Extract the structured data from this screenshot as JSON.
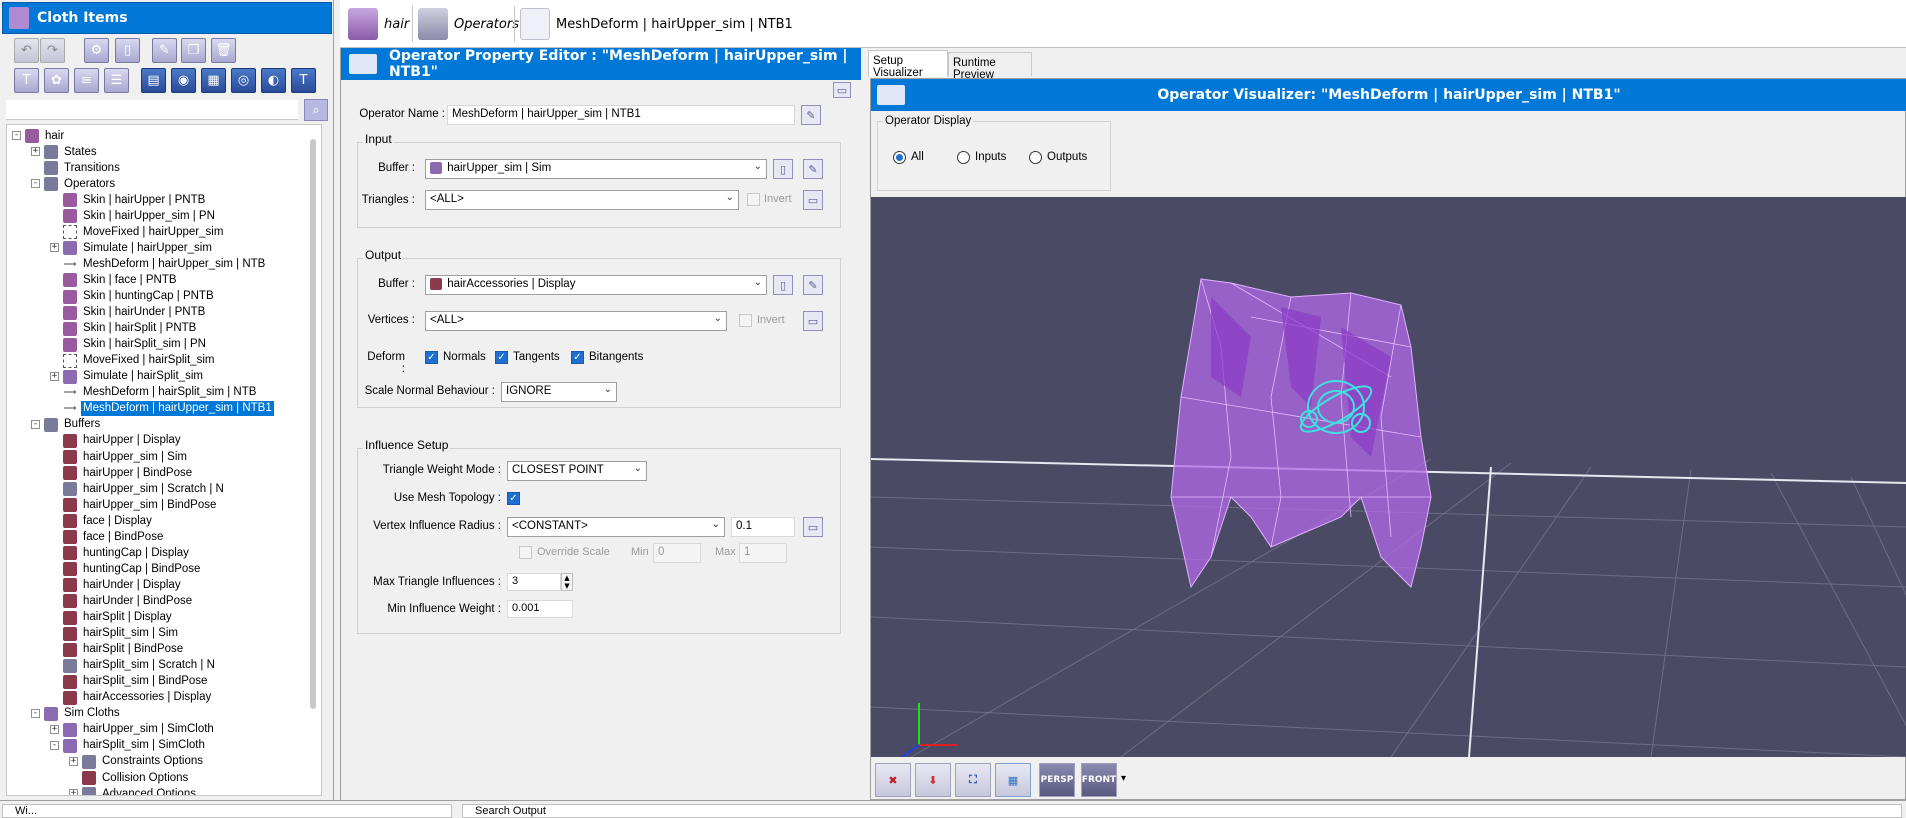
{
  "left_panel": {
    "title": "Cloth Items",
    "search": {
      "value": ""
    },
    "tree": [
      {
        "label": "hair",
        "depth": 0,
        "icon": "cloth-icon",
        "expander": "-",
        "kind": "T"
      },
      {
        "label": "States",
        "depth": 1,
        "icon": "states-icon",
        "expander": "+",
        "kind": "op"
      },
      {
        "label": "Transitions",
        "depth": 1,
        "icon": "transitions-icon",
        "expander": "",
        "kind": "op"
      },
      {
        "label": "Operators",
        "depth": 1,
        "icon": "operators-icon",
        "expander": "-",
        "kind": "op"
      },
      {
        "label": "Skin | hairUpper | PNTB",
        "depth": 2,
        "icon": "skin-icon",
        "expander": "",
        "kind": "T"
      },
      {
        "label": "Skin | hairUpper_sim | PN",
        "depth": 2,
        "icon": "skin-icon",
        "expander": "",
        "kind": "T"
      },
      {
        "label": "MoveFixed | hairUpper_sim",
        "depth": 2,
        "icon": "movefixed-icon",
        "expander": "",
        "kind": "mv"
      },
      {
        "label": "Simulate | hairUpper_sim",
        "depth": 2,
        "icon": "simulate-icon",
        "expander": "+",
        "kind": "sim"
      },
      {
        "label": "MeshDeform | hairUpper_sim | NTB",
        "depth": 2,
        "icon": "meshdeform-icon",
        "expander": "",
        "kind": "md"
      },
      {
        "label": "Skin | face | PNTB",
        "depth": 2,
        "icon": "skin-icon",
        "expander": "",
        "kind": "T"
      },
      {
        "label": "Skin | huntingCap | PNTB",
        "depth": 2,
        "icon": "skin-icon",
        "expander": "",
        "kind": "T"
      },
      {
        "label": "Skin | hairUnder | PNTB",
        "depth": 2,
        "icon": "skin-icon",
        "expander": "",
        "kind": "T"
      },
      {
        "label": "Skin | hairSplit | PNTB",
        "depth": 2,
        "icon": "skin-icon",
        "expander": "",
        "kind": "T"
      },
      {
        "label": "Skin | hairSplit_sim | PN",
        "depth": 2,
        "icon": "skin-icon",
        "expander": "",
        "kind": "T"
      },
      {
        "label": "MoveFixed | hairSplit_sim",
        "depth": 2,
        "icon": "movefixed-icon",
        "expander": "",
        "kind": "mv"
      },
      {
        "label": "Simulate | hairSplit_sim",
        "depth": 2,
        "icon": "simulate-icon",
        "expander": "+",
        "kind": "sim"
      },
      {
        "label": "MeshDeform | hairSplit_sim | NTB",
        "depth": 2,
        "icon": "meshdeform-icon",
        "expander": "",
        "kind": "md"
      },
      {
        "label": "MeshDeform | hairUpper_sim | NTB1",
        "depth": 2,
        "icon": "meshdeform-icon",
        "expander": "",
        "kind": "md",
        "selected": true
      },
      {
        "label": "Buffers",
        "depth": 1,
        "icon": "buffers-icon",
        "expander": "-",
        "kind": "op"
      },
      {
        "label": "hairUpper | Display",
        "depth": 2,
        "icon": "buffer-icon",
        "expander": "",
        "kind": "buf"
      },
      {
        "label": "hairUpper_sim | Sim",
        "depth": 2,
        "icon": "buffer-icon",
        "expander": "",
        "kind": "buf"
      },
      {
        "label": "hairUpper | BindPose",
        "depth": 2,
        "icon": "buffer-icon",
        "expander": "",
        "kind": "buf"
      },
      {
        "label": "hairUpper_sim | Scratch | N",
        "depth": 2,
        "icon": "scratch-buffer-icon",
        "expander": "",
        "kind": "op"
      },
      {
        "label": "hairUpper_sim | BindPose",
        "depth": 2,
        "icon": "buffer-icon",
        "expander": "",
        "kind": "buf"
      },
      {
        "label": "face | Display",
        "depth": 2,
        "icon": "buffer-icon",
        "expander": "",
        "kind": "buf"
      },
      {
        "label": "face | BindPose",
        "depth": 2,
        "icon": "buffer-icon",
        "expander": "",
        "kind": "buf"
      },
      {
        "label": "huntingCap | Display",
        "depth": 2,
        "icon": "buffer-icon",
        "expander": "",
        "kind": "buf"
      },
      {
        "label": "huntingCap | BindPose",
        "depth": 2,
        "icon": "buffer-icon",
        "expander": "",
        "kind": "buf"
      },
      {
        "label": "hairUnder | Display",
        "depth": 2,
        "icon": "buffer-icon",
        "expander": "",
        "kind": "buf"
      },
      {
        "label": "hairUnder | BindPose",
        "depth": 2,
        "icon": "buffer-icon",
        "expander": "",
        "kind": "buf"
      },
      {
        "label": "hairSplit | Display",
        "depth": 2,
        "icon": "buffer-icon",
        "expander": "",
        "kind": "buf"
      },
      {
        "label": "hairSplit_sim | Sim",
        "depth": 2,
        "icon": "buffer-icon",
        "expander": "",
        "kind": "buf"
      },
      {
        "label": "hairSplit | BindPose",
        "depth": 2,
        "icon": "buffer-icon",
        "expander": "",
        "kind": "buf"
      },
      {
        "label": "hairSplit_sim | Scratch | N",
        "depth": 2,
        "icon": "scratch-buffer-icon",
        "expander": "",
        "kind": "op"
      },
      {
        "label": "hairSplit_sim | BindPose",
        "depth": 2,
        "icon": "buffer-icon",
        "expander": "",
        "kind": "buf"
      },
      {
        "label": "hairAccessories | Display",
        "depth": 2,
        "icon": "buffer-icon",
        "expander": "",
        "kind": "buf"
      },
      {
        "label": "Sim Cloths",
        "depth": 1,
        "icon": "simcloths-icon",
        "expander": "-",
        "kind": "sim"
      },
      {
        "label": "hairUpper_sim | SimCloth",
        "depth": 2,
        "icon": "simcloth-icon",
        "expander": "+",
        "kind": "sim"
      },
      {
        "label": "hairSplit_sim | SimCloth",
        "depth": 2,
        "icon": "simcloth-icon",
        "expander": "-",
        "kind": "sim"
      },
      {
        "label": "Constraints Options",
        "depth": 3,
        "icon": "constraints-icon",
        "expander": "+",
        "kind": "op"
      },
      {
        "label": "Collision Options",
        "depth": 3,
        "icon": "collision-icon",
        "expander": "",
        "kind": "buf"
      },
      {
        "label": "Advanced Options",
        "depth": 3,
        "icon": "advanced-icon",
        "expander": "+",
        "kind": "op"
      }
    ]
  },
  "breadcrumb": {
    "items": [
      "hair",
      "Operators",
      "MeshDeform | hairUpper_sim | NTB1"
    ]
  },
  "property_editor": {
    "title": "Operator Property Editor : \"MeshDeform | hairUpper_sim | NTB1\"",
    "operator_name_label": "Operator Name :",
    "operator_name_value": "MeshDeform | hairUpper_sim | NTB1",
    "input": {
      "group_label": "Input",
      "buffer_label": "Buffer :",
      "buffer_value": "hairUpper_sim | Sim",
      "triangles_label": "Triangles :",
      "triangles_value": "<ALL>",
      "invert_label": "Invert"
    },
    "output": {
      "group_label": "Output",
      "buffer_label": "Buffer :",
      "buffer_value": "hairAccessories | Display",
      "vertices_label": "Vertices :",
      "vertices_value": "<ALL>",
      "invert_label": "Invert",
      "deform_label": "Deform :",
      "normals_label": "Normals",
      "tangents_label": "Tangents",
      "bitangents_label": "Bitangents",
      "scale_normal_label": "Scale Normal Behaviour :",
      "scale_normal_value": "IGNORE"
    },
    "influence": {
      "group_label": "Influence Setup",
      "tri_weight_label": "Triangle Weight Mode :",
      "tri_weight_value": "CLOSEST POINT",
      "use_mesh_topology_label": "Use Mesh Topology :",
      "vertex_radius_label": "Vertex Influence Radius :",
      "vertex_radius_mode": "<CONSTANT>",
      "vertex_radius_value": "0.1",
      "override_scale_label": "Override Scale",
      "min_label": "Min",
      "min_value": "0",
      "max_label": "Max",
      "max_value": "1",
      "max_tri_label": "Max Triangle Influences :",
      "max_tri_value": "3",
      "min_weight_label": "Min Influence Weight :",
      "min_weight_value": "0.001"
    }
  },
  "visualizer": {
    "tabs": [
      "Setup Visualizer",
      "Runtime Preview"
    ],
    "title": "Operator Visualizer: \"MeshDeform | hairUpper_sim | NTB1\"",
    "display_group_label": "Operator Display",
    "radio_all": "All",
    "radio_inputs": "Inputs",
    "radio_outputs": "Outputs",
    "toolbar": {
      "persp_label": "PERSP",
      "front_label": "FRONT"
    }
  },
  "bottom_tabs": {
    "left": "Wi...",
    "right": "Search Output"
  },
  "colors": {
    "accent": "#0078d7",
    "viewport_bg": "#4a4a64",
    "mesh": "#c070f0",
    "accessory": "#40e0e0"
  }
}
